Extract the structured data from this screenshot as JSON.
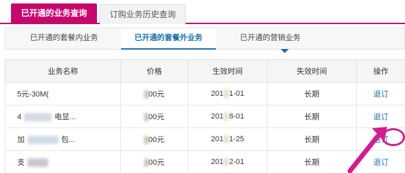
{
  "top_tabs": [
    {
      "label": "已开通的业务查询"
    },
    {
      "label": "订购业务历史查询"
    }
  ],
  "sub_tabs": [
    {
      "label": "已开通的套餐内业务"
    },
    {
      "label": "已开通的套餐外业务"
    },
    {
      "label": "已开通的营销业务"
    }
  ],
  "table": {
    "headers": [
      "业务名称",
      "价格",
      "生效时间",
      "失效时间",
      "操作"
    ],
    "rows": [
      {
        "name": "5元-30M(",
        "price": "00元",
        "start": "1-01",
        "start_prefix": "",
        "end": "长期",
        "action": "退订"
      },
      {
        "name": "4",
        "name_suffix": "电显...",
        "price": "00元",
        "start": "8-01",
        "start_prefix": "201",
        "end": "长期",
        "action": "退订"
      },
      {
        "name": "加",
        "name_suffix": "包...",
        "price": "00元",
        "start": "1-25",
        "start_prefix": "201",
        "end": "长期",
        "action": "退订"
      },
      {
        "name": "支",
        "name_suffix": "",
        "price": "00元",
        "start": "2-01",
        "start_prefix": "201",
        "end": "长期",
        "action": "退订"
      }
    ]
  },
  "colors": {
    "brand": "#c8076e",
    "link": "#1b6ea8",
    "annotation": "#d11d8f"
  }
}
